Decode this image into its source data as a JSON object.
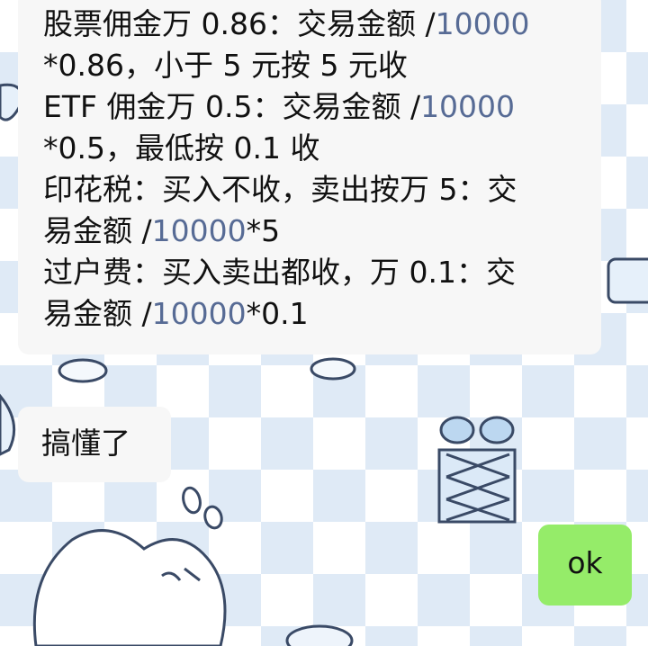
{
  "messages": [
    {
      "sender": "other",
      "lines": [
        {
          "prefix": "股票佣金万 0.86：交易金额 /",
          "number": "10000",
          "suffix": ""
        },
        {
          "prefix": "*0.86，小于 5 元按 5 元收",
          "number": "",
          "suffix": ""
        },
        {
          "prefix": "ETF 佣金万 0.5：交易金额 /",
          "number": "10000",
          "suffix": ""
        },
        {
          "prefix": "*0.5，最低按 0.1 收",
          "number": "",
          "suffix": ""
        },
        {
          "prefix": "印花税：买入不收，卖出按万 5：交",
          "number": "",
          "suffix": ""
        },
        {
          "prefix": "易金额 /",
          "number": "10000",
          "suffix": "*5"
        },
        {
          "prefix": "过户费：买入卖出都收，万 0.1：交",
          "number": "",
          "suffix": ""
        },
        {
          "prefix": "易金额 /",
          "number": "10000",
          "suffix": "*0.1"
        }
      ]
    },
    {
      "sender": "other",
      "text": "搞懂了"
    },
    {
      "sender": "self",
      "text": "ok"
    }
  ],
  "colors": {
    "other_bubble": "#f7f7f7",
    "self_bubble": "#95ec69",
    "link_number": "#576b95",
    "wallpaper_check": "#dfeaf6"
  }
}
